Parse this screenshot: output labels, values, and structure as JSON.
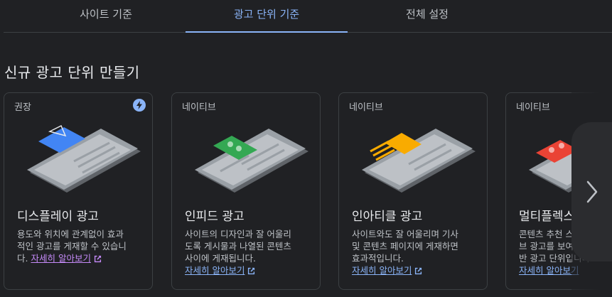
{
  "tabs": [
    {
      "label": "사이트 기준"
    },
    {
      "label": "광고 단위 기준"
    },
    {
      "label": "전체 설정"
    }
  ],
  "section_title": "신규 광고 단위 만들기",
  "cards": [
    {
      "tag": "권장",
      "title": "디스플레이 광고",
      "desc_lines": [
        "용도와 위치에 관계없이 효과",
        "적인 광고를 게재할 수 있습니",
        "다."
      ],
      "learn_more": "자세히 알아보기",
      "accent": "#4285f4"
    },
    {
      "tag": "네이티브",
      "title": "인피드 광고",
      "desc_lines": [
        "사이트의 디자인과 잘 어울리",
        "도록 게시물과 나열된 콘텐츠",
        "사이에 게재됩니다."
      ],
      "learn_more": "자세히 알아보기",
      "accent": "#34a853"
    },
    {
      "tag": "네이티브",
      "title": "인아티클 광고",
      "desc_lines": [
        "사이트와도 잘 어울리며 기사",
        "및 콘텐츠 페이지에 게재하면",
        "효과적입니다."
      ],
      "learn_more": "자세히 알아보기",
      "accent": "#f9ab00"
    },
    {
      "tag": "네이티브",
      "title": "멀티플렉스 광고",
      "desc_lines": [
        "콘텐츠 추천 스타일의 그리드",
        "브 광고를 보여 주는 그리드",
        "반 광고 단위입니다."
      ],
      "learn_more": "자세히 알아보기",
      "accent": "#ea4335"
    }
  ],
  "icons": {
    "badge": "bolt-icon",
    "external": "open-in-new-icon",
    "next": "chevron-right-icon"
  },
  "colors": {
    "background": "#202124",
    "accent_blue": "#8ab4f8",
    "visited_link": "#c58af9",
    "text_secondary": "#bdc1c6"
  }
}
